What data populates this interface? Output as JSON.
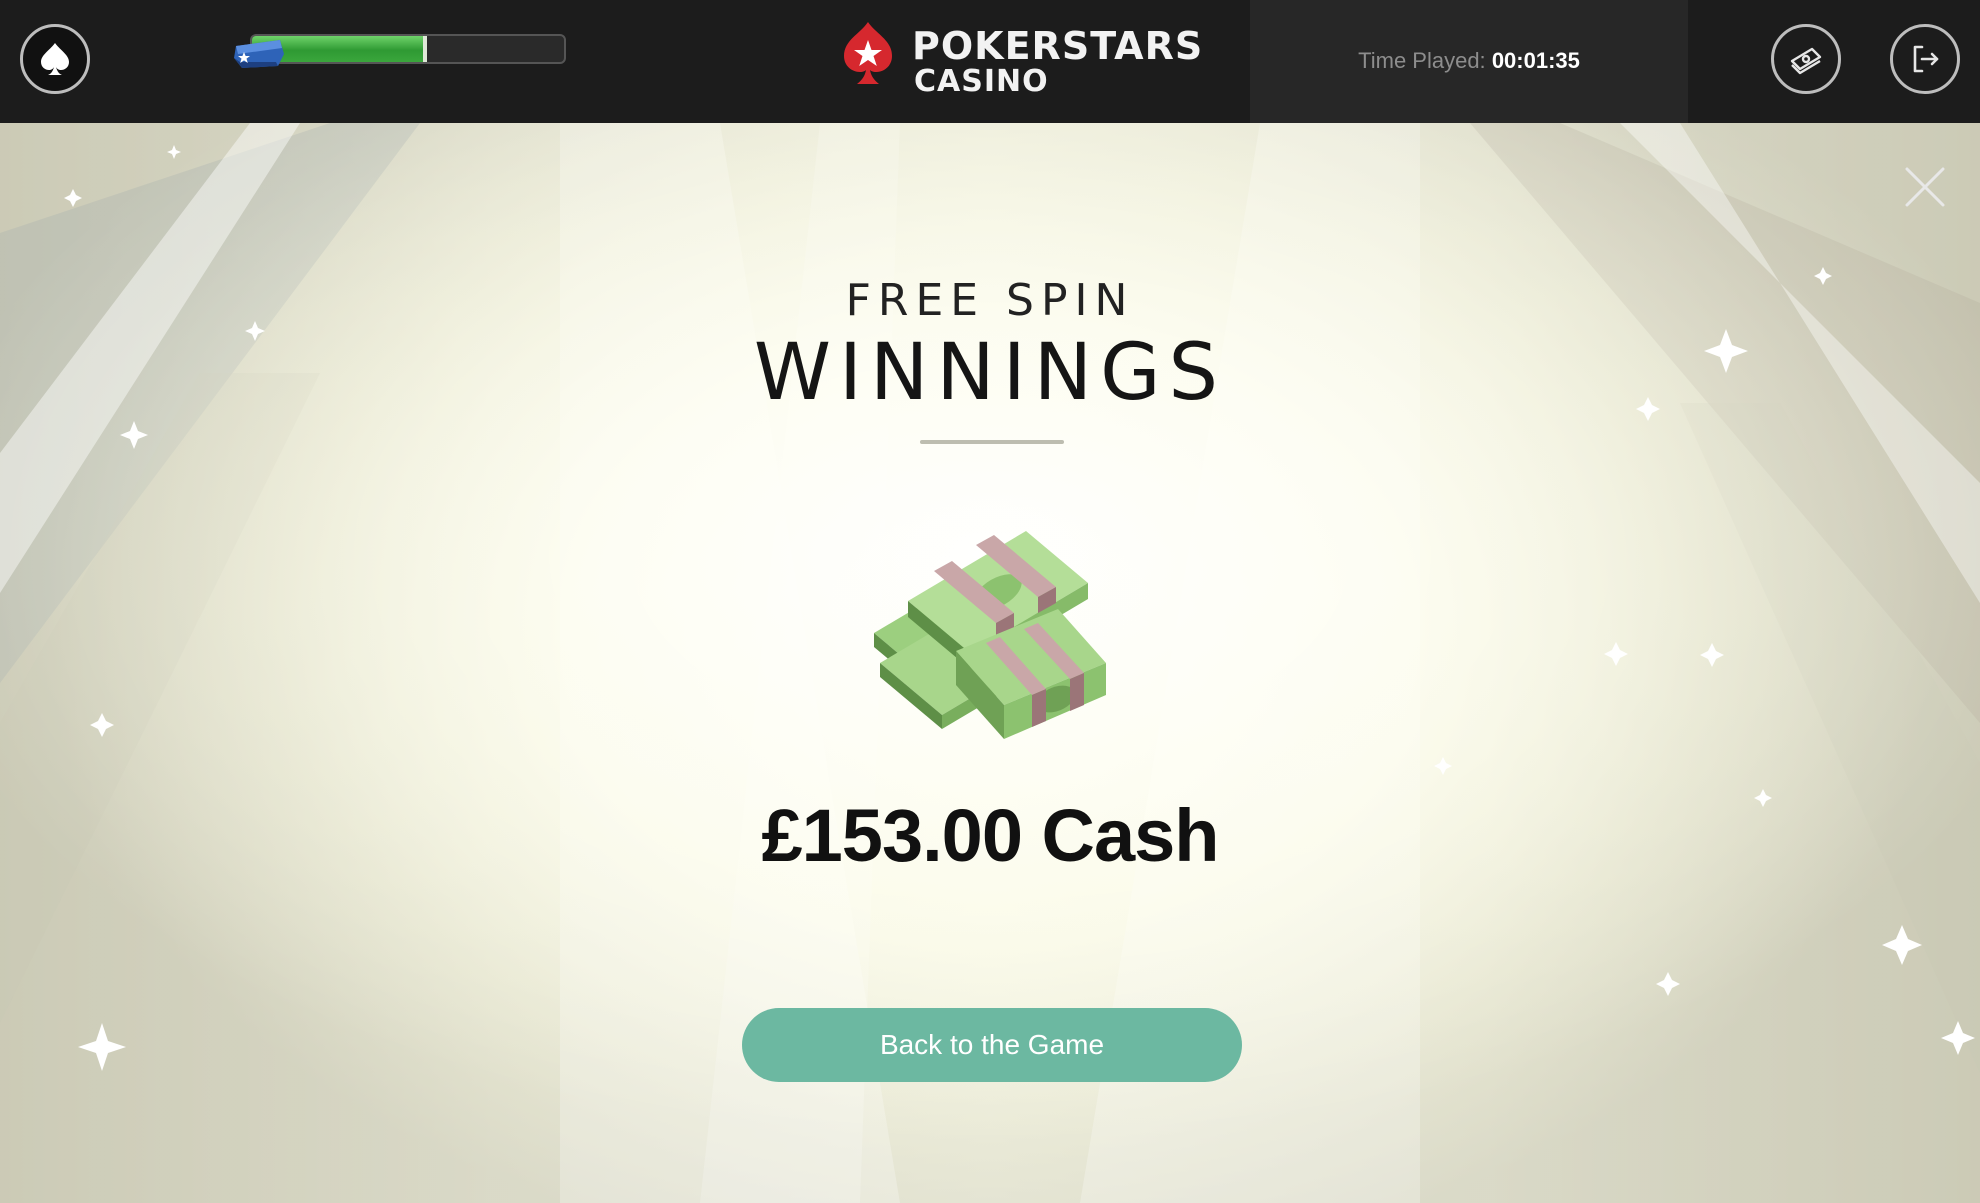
{
  "header": {
    "brand": {
      "line1": "POKERSTARS",
      "line2": "CASINO"
    },
    "level_progress": 0.56,
    "time_played": {
      "label": "Time Played:",
      "value": "00:01:35"
    },
    "icons": {
      "menu": "spade-icon",
      "level": "chest-badge-icon",
      "cashier": "cash-icon",
      "logout": "logout-icon"
    }
  },
  "popup": {
    "subtitle": "FREE SPIN",
    "title": "WINNINGS",
    "prize_icon": "cash-stacks-icon",
    "amount": "£153.00 Cash",
    "back_button": "Back to the Game",
    "close_icon": "close-icon"
  },
  "colors": {
    "brand_red": "#d6282e",
    "button": "#6cb8a1",
    "progress": "#3aa63c"
  }
}
